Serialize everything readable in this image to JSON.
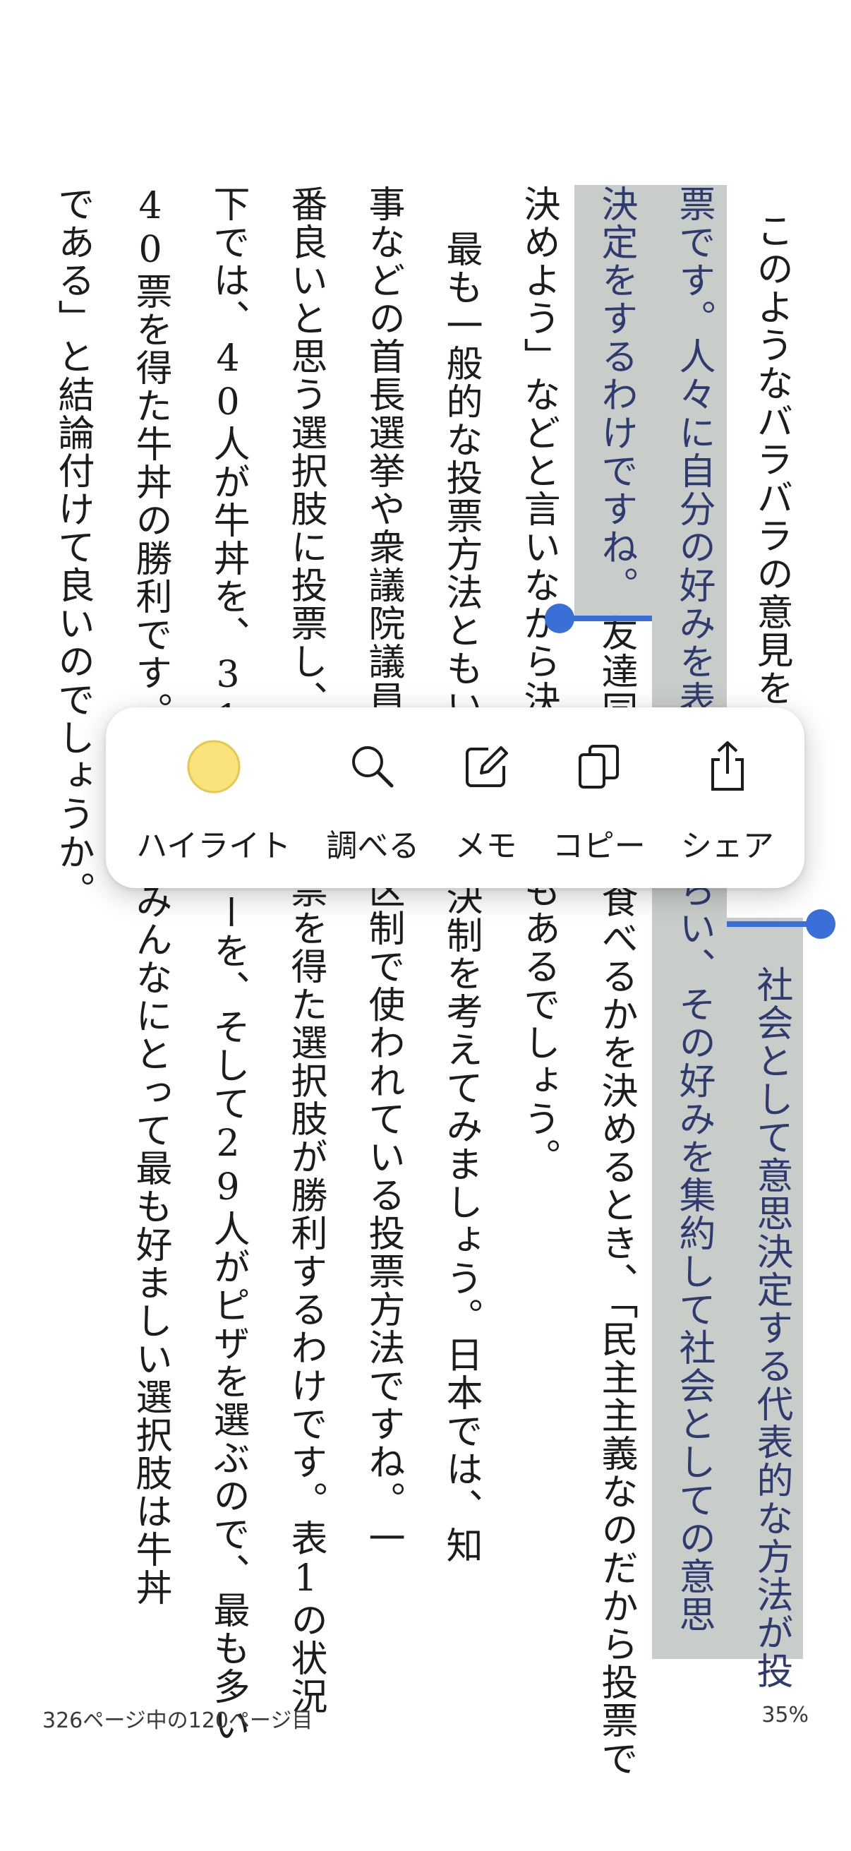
{
  "page": {
    "columns": [
      "このようなバラバラの意見を",
      "票です。人々に自分の好みを表明してもらい、その好みを集約して社会としての意思",
      "決定をするわけですね。",
      "友達同士で何を食べるかを決めるとき、「民主主義なのだから投票で",
      "決めよう」などと言いながら決めることもあるでしょう。",
      "最も一般的な投票方法ともいえる多数決制を考えてみましょう。日本では、知",
      "事などの首長選挙や衆議院議員の小選挙区制で使われている投票方法ですね。一",
      "番良いと思う選択肢に投票し、最も多く票を得た選択肢が勝利するわけです。表1の状況",
      "下では、40人が牛丼を、31人がカレーを、そして29人がピザを選ぶので、最も多い",
      "40票を得た牛丼の勝利です。つまり「みんなにとって最も好ましい選択肢は牛丼",
      "である」と結論付けて良いのでしょうか。"
    ],
    "col0_tail": "社会として意思決定する代表的な方法が投"
  },
  "menu": {
    "items": [
      {
        "label": "ハイライト",
        "icon": "highlight-color-icon"
      },
      {
        "label": "調べる",
        "icon": "search-icon"
      },
      {
        "label": "メモ",
        "icon": "note-edit-icon"
      },
      {
        "label": "コピー",
        "icon": "copy-icon"
      },
      {
        "label": "シェア",
        "icon": "share-icon"
      }
    ]
  },
  "footer": {
    "page_info": "326ページ中の120ページ目",
    "progress": "35%"
  },
  "colors": {
    "highlight": "#c9cdca",
    "selection_handle": "#3a6fd8",
    "highlight_swatch": "#fbe37c"
  }
}
